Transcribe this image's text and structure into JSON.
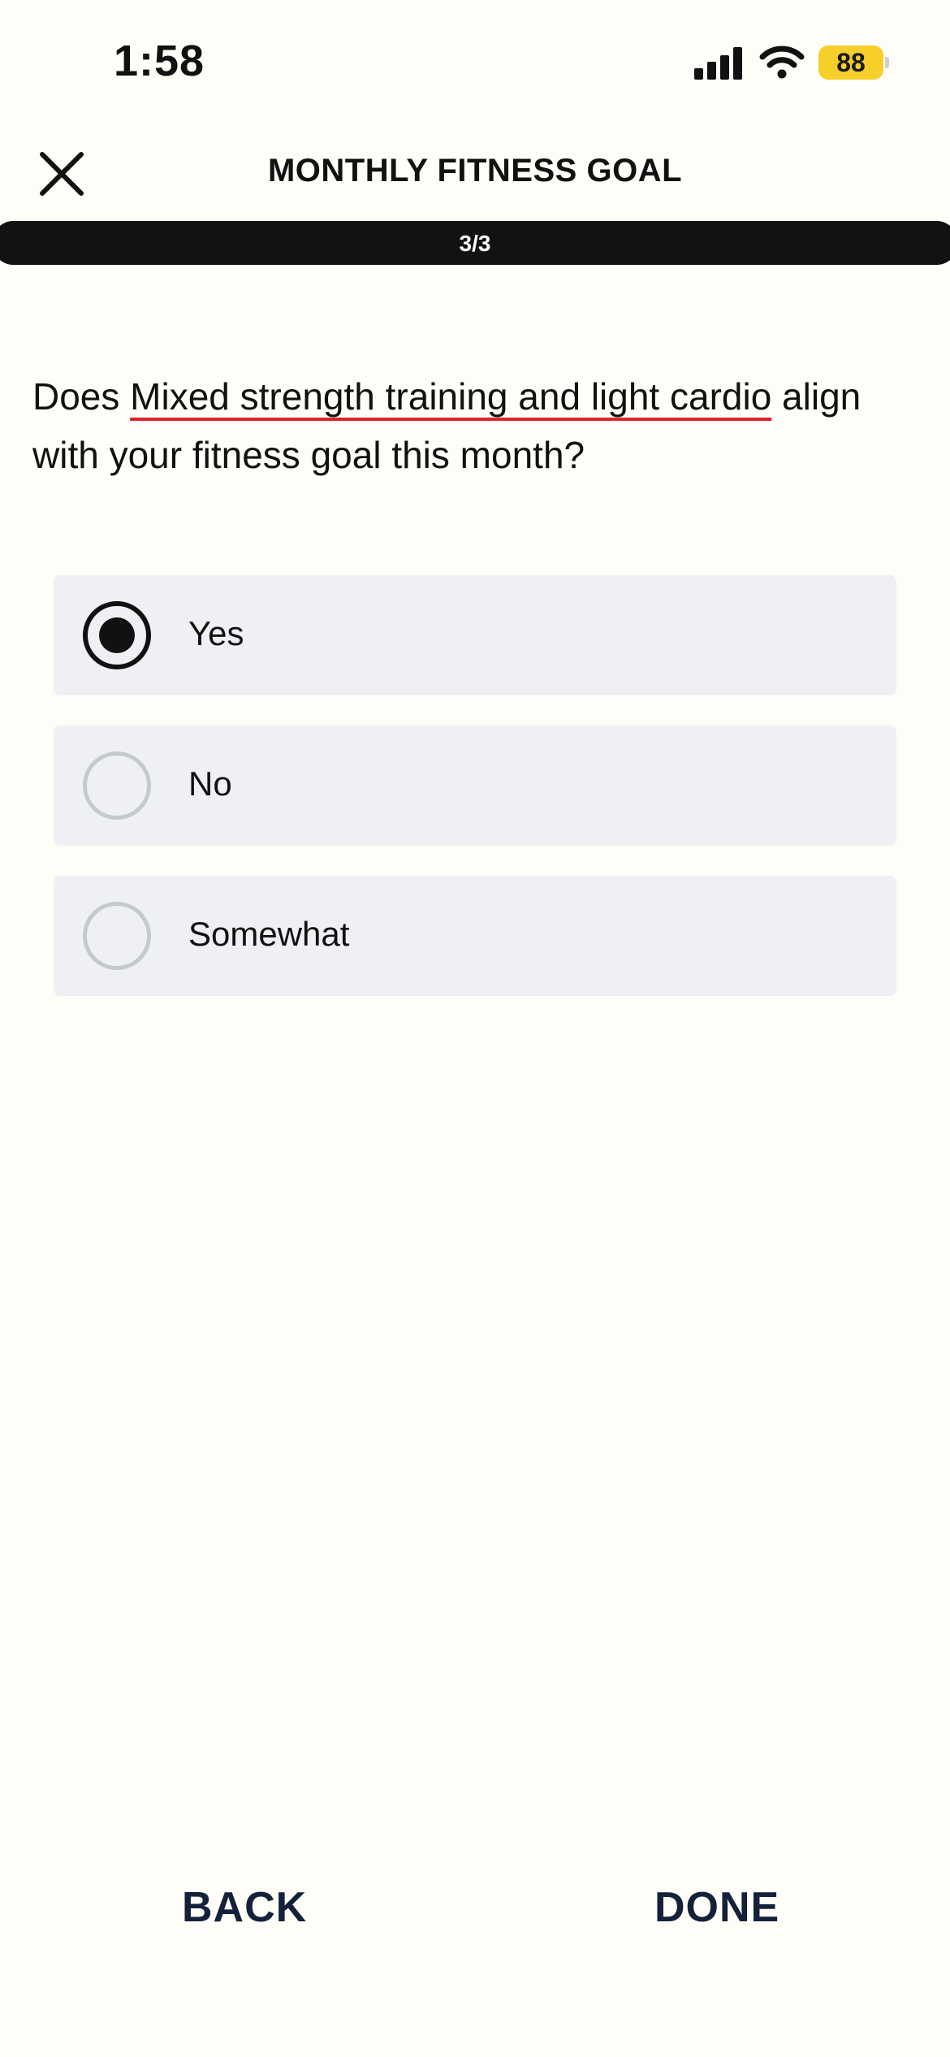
{
  "status_bar": {
    "time": "1:58",
    "battery": "88",
    "battery_color": "#f7cf2a"
  },
  "header": {
    "title": "MONTHLY FITNESS GOAL",
    "close_icon": "close-icon"
  },
  "progress": {
    "label": "3/3",
    "current": 3,
    "total": 3,
    "fraction": 1.0
  },
  "question": {
    "prefix": "Does ",
    "highlight": "Mixed strength training and light cardio",
    "suffix": " align with your fitness goal this month?",
    "highlight_underline_color": "#d9232e"
  },
  "options": [
    {
      "label": "Yes",
      "selected": true
    },
    {
      "label": "No",
      "selected": false
    },
    {
      "label": "Somewhat",
      "selected": false
    }
  ],
  "footer": {
    "back_label": "BACK",
    "done_label": "DONE"
  },
  "colors": {
    "background": "#fffdf7",
    "option_background": "#eff0f3",
    "footer_text": "#14213a"
  }
}
